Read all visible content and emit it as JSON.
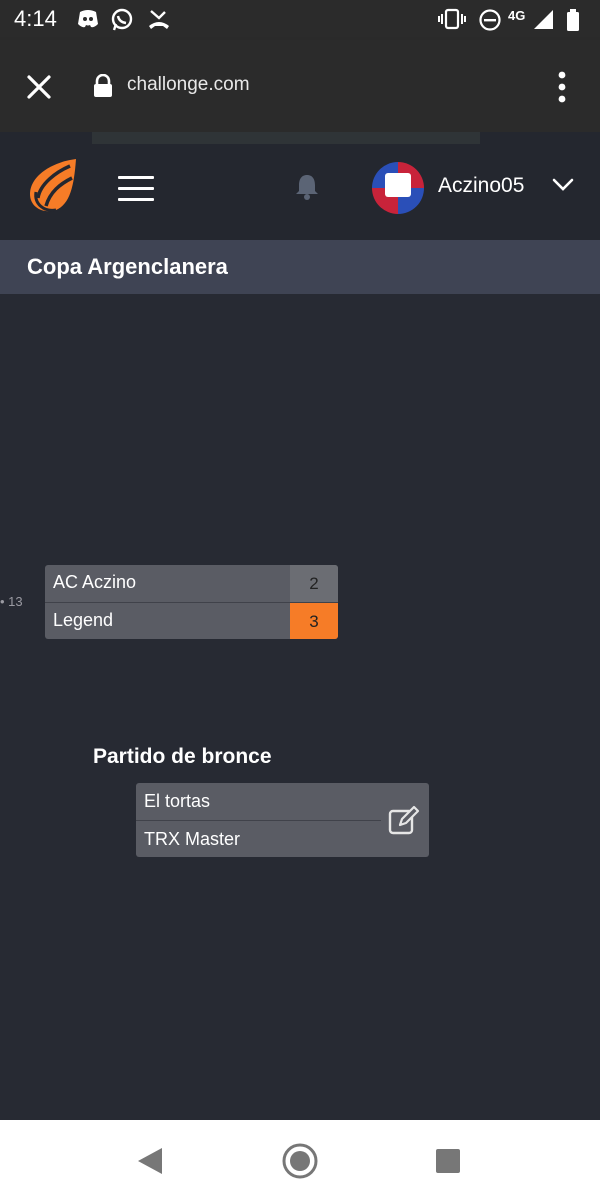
{
  "status_bar": {
    "time": "4:14",
    "network": "4G",
    "icons": [
      "discord-icon",
      "whatsapp-icon",
      "missed-call-icon",
      "vibrate-icon",
      "do-not-disturb-icon",
      "signal-icon",
      "battery-icon"
    ]
  },
  "browser": {
    "url": "challonge.com",
    "close_icon": "close-icon",
    "lock_icon": "lock-icon",
    "menu_icon": "more-vert-icon"
  },
  "header": {
    "username": "Aczino05",
    "accent": "#f67c27"
  },
  "page": {
    "title": "Copa Argenclanera"
  },
  "bracket": {
    "final_match": {
      "number": "13",
      "players": [
        {
          "name": "AC Aczino",
          "score": "2",
          "winner": false
        },
        {
          "name": "Legend",
          "score": "3",
          "winner": true
        }
      ]
    },
    "bronze": {
      "title": "Partido de bronce",
      "players": [
        {
          "name": "El tortas"
        },
        {
          "name": "TRX Master"
        }
      ]
    }
  },
  "nav": {
    "buttons": [
      "back-icon",
      "home-icon",
      "recents-icon"
    ]
  }
}
